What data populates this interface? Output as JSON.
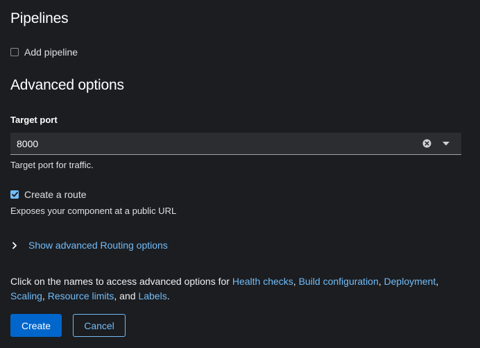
{
  "pipelines": {
    "title": "Pipelines",
    "add_pipeline_label": "Add pipeline",
    "add_pipeline_checked": false
  },
  "advanced": {
    "title": "Advanced options",
    "target_port": {
      "label": "Target port",
      "value": "8000",
      "helper": "Target port for traffic."
    },
    "route": {
      "label": "Create a route",
      "checked": true,
      "helper": "Exposes your component at a public URL"
    },
    "routing_toggle": "Show advanced Routing options"
  },
  "info": {
    "prefix": "Click on the names to access advanced options for ",
    "health_checks": "Health checks",
    "build_configuration": "Build configuration",
    "deployment": "Deployment",
    "scaling": "Scaling",
    "resource_limits": "Resource limits",
    "labels": "Labels",
    "sep1": ", ",
    "sep2": ", ",
    "sep3": ",",
    "sep4": ", ",
    "sep5": ", and ",
    "suffix": "."
  },
  "actions": {
    "create_label": "Create",
    "cancel_label": "Cancel"
  },
  "colors": {
    "background": "#1b1d21",
    "link": "#73bcf7",
    "primary_button": "#0066cc",
    "input_background": "#2b2d31"
  },
  "icons": {
    "clear": "times-circle-icon",
    "caret": "caret-down-icon",
    "expand": "chevron-right-icon",
    "check": "check-icon"
  }
}
